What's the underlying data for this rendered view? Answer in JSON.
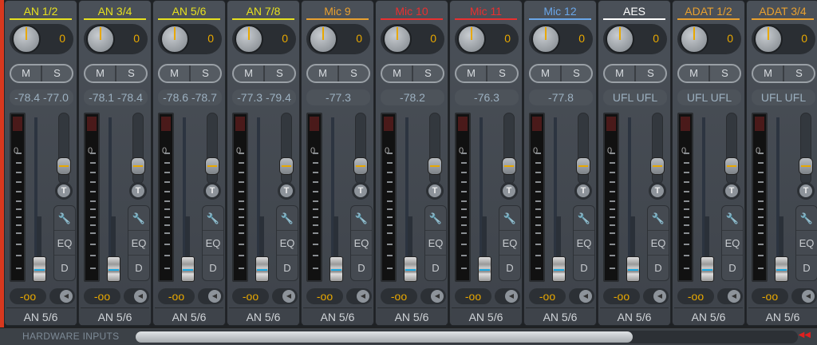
{
  "section_label": "HARDWARE INPUTS",
  "scroll_position_fraction": 0.75,
  "channels": [
    {
      "name": "AN 1/2",
      "color": "#e6e020",
      "gain": "0",
      "mute": "M",
      "solo": "S",
      "level": "-78.4 -77.0",
      "fader": "-oo",
      "routing": "AN 5/6"
    },
    {
      "name": "AN 3/4",
      "color": "#e6e020",
      "gain": "0",
      "mute": "M",
      "solo": "S",
      "level": "-78.1 -78.4",
      "fader": "-oo",
      "routing": "AN 5/6"
    },
    {
      "name": "AN 5/6",
      "color": "#e6e020",
      "gain": "0",
      "mute": "M",
      "solo": "S",
      "level": "-78.6 -78.7",
      "fader": "-oo",
      "routing": "AN 5/6"
    },
    {
      "name": "AN 7/8",
      "color": "#e6e020",
      "gain": "0",
      "mute": "M",
      "solo": "S",
      "level": "-77.3 -79.4",
      "fader": "-oo",
      "routing": "AN 5/6"
    },
    {
      "name": "Mic 9",
      "color": "#e8a030",
      "gain": "0",
      "mute": "M",
      "solo": "S",
      "level": "-77.3",
      "fader": "-oo",
      "routing": "AN 5/6"
    },
    {
      "name": "Mic 10",
      "color": "#e83030",
      "gain": "0",
      "mute": "M",
      "solo": "S",
      "level": "-78.2",
      "fader": "-oo",
      "routing": "AN 5/6"
    },
    {
      "name": "Mic 11",
      "color": "#e83030",
      "gain": "0",
      "mute": "M",
      "solo": "S",
      "level": "-76.3",
      "fader": "-oo",
      "routing": "AN 5/6"
    },
    {
      "name": "Mic 12",
      "color": "#6aa6e8",
      "gain": "0",
      "mute": "M",
      "solo": "S",
      "level": "-77.8",
      "fader": "-oo",
      "routing": "AN 5/6"
    },
    {
      "name": "AES",
      "color": "#ffffff",
      "gain": "0",
      "mute": "M",
      "solo": "S",
      "level": "UFL  UFL",
      "fader": "-oo",
      "routing": "AN 5/6"
    },
    {
      "name": "ADAT 1/2",
      "color": "#e8a030",
      "gain": "0",
      "mute": "M",
      "solo": "S",
      "level": "UFL  UFL",
      "fader": "-oo",
      "routing": "AN 5/6"
    },
    {
      "name": "ADAT 3/4",
      "color": "#e8a030",
      "gain": "0",
      "mute": "M",
      "solo": "S",
      "level": "UFL  UFL",
      "fader": "-oo",
      "routing": "AN 5/6"
    }
  ],
  "meter_zero_label": "0",
  "trim_label": "T",
  "eq_label": "EQ",
  "dynamics_label": "D"
}
